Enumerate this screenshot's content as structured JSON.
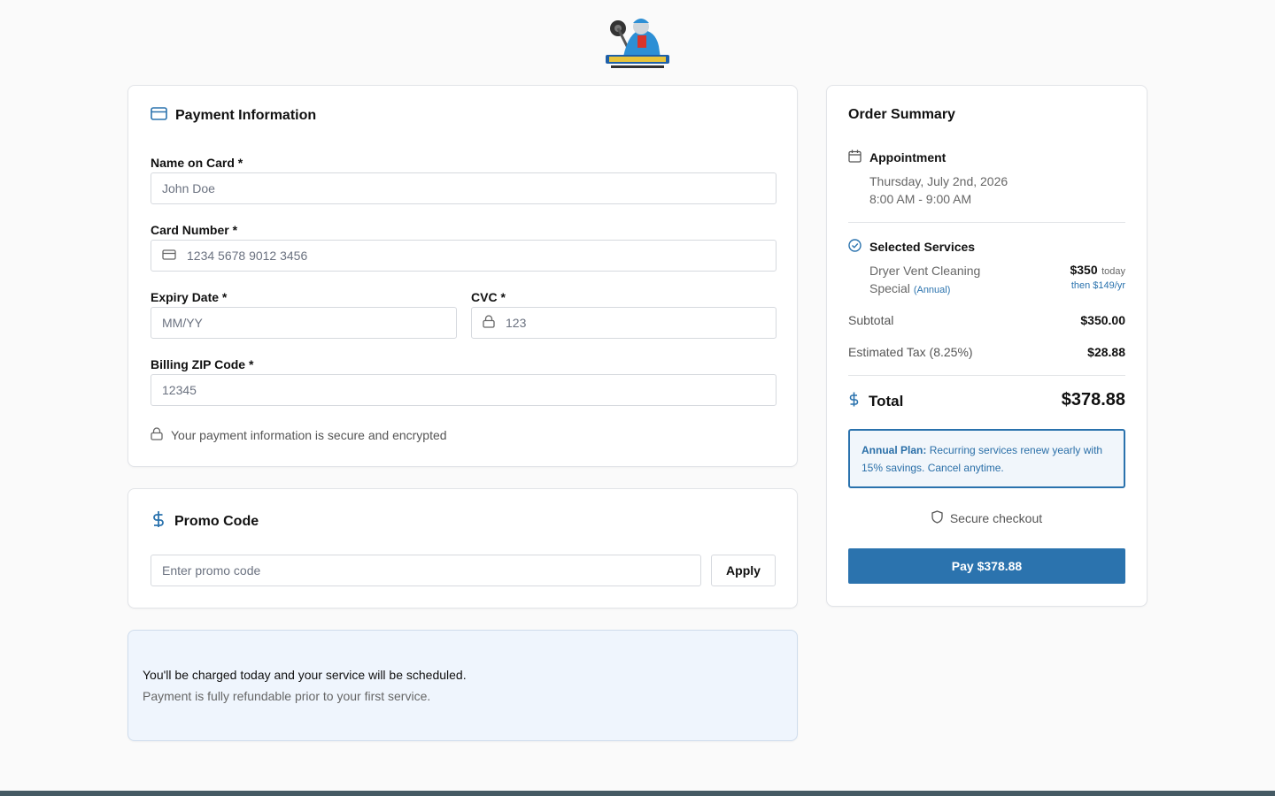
{
  "logo": {
    "alt": "Dryer Vent Superheroes logo"
  },
  "payment": {
    "title": "Payment Information",
    "name_label": "Name on Card *",
    "name_placeholder": "John Doe",
    "card_label": "Card Number *",
    "card_placeholder": "1234 5678 9012 3456",
    "expiry_label": "Expiry Date *",
    "expiry_placeholder": "MM/YY",
    "cvc_label": "CVC *",
    "cvc_placeholder": "123",
    "zip_label": "Billing ZIP Code *",
    "zip_placeholder": "12345",
    "secure_note": "Your payment information is secure and encrypted"
  },
  "promo": {
    "title": "Promo Code",
    "placeholder": "Enter promo code",
    "apply_label": "Apply"
  },
  "notice": {
    "main": "You'll be charged today and your service will be scheduled.",
    "sub": "Payment is fully refundable prior to your first service."
  },
  "summary": {
    "title": "Order Summary",
    "appointment_label": "Appointment",
    "appointment_date": "Thursday, July 2nd, 2026",
    "appointment_time": "8:00 AM - 9:00 AM",
    "services_label": "Selected Services",
    "service_name_line1": "Dryer Vent Cleaning",
    "service_name_line2": "Special",
    "service_badge": "(Annual)",
    "service_price": "$350",
    "service_price_suffix": "today",
    "service_recurring": "then $149/yr",
    "subtotal_label": "Subtotal",
    "subtotal_value": "$350.00",
    "tax_label": "Estimated Tax (8.25%)",
    "tax_value": "$28.88",
    "total_label": "Total",
    "total_value": "$378.88",
    "plan_bold": "Annual Plan:",
    "plan_text": "Recurring services renew yearly with 15% savings. Cancel anytime.",
    "secure_checkout": "Secure checkout",
    "pay_label": "Pay $378.88"
  },
  "colors": {
    "accent": "#2b73ae",
    "footer": "#455a64",
    "notice_bg": "#eff5fd"
  }
}
